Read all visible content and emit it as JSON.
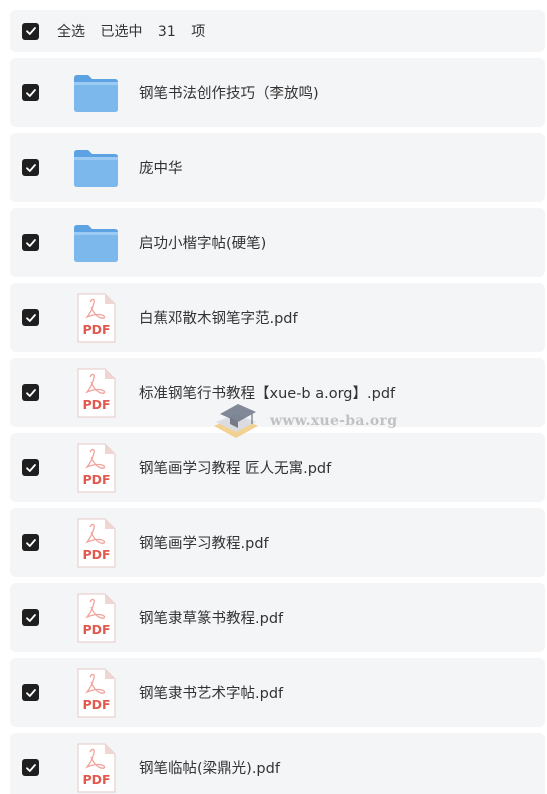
{
  "header": {
    "select_all_label": "全选",
    "selected_prefix": "已选中",
    "selected_count": "31",
    "selected_suffix": "项"
  },
  "items": [
    {
      "name": "钢笔书法创作技巧（李放鸣)",
      "type": "folder",
      "checked": true
    },
    {
      "name": "庞中华",
      "type": "folder",
      "checked": true
    },
    {
      "name": "启功小楷字帖(硬笔)",
      "type": "folder",
      "checked": true
    },
    {
      "name": "白蕉邓散木钢笔字范.pdf",
      "type": "pdf",
      "checked": true
    },
    {
      "name": "标准钢笔行书教程【xue-b a.org】.pdf",
      "type": "pdf",
      "checked": true
    },
    {
      "name": "钢笔画学习教程 匠人无寓.pdf",
      "type": "pdf",
      "checked": true
    },
    {
      "name": "钢笔画学习教程.pdf",
      "type": "pdf",
      "checked": true
    },
    {
      "name": "钢笔隶草篆书教程.pdf",
      "type": "pdf",
      "checked": true
    },
    {
      "name": "钢笔隶书艺术字帖.pdf",
      "type": "pdf",
      "checked": true
    },
    {
      "name": "钢笔临帖(梁鼎光).pdf",
      "type": "pdf",
      "checked": true
    }
  ],
  "pdf_icon_text": "PDF",
  "watermark": {
    "text": "www.xue-ba.org"
  },
  "colors": {
    "row_background": "#f4f5f7",
    "checkbox": "#1f1f1f",
    "folder_blue": "#7cb8ec",
    "pdf_red": "#e25a4f"
  }
}
